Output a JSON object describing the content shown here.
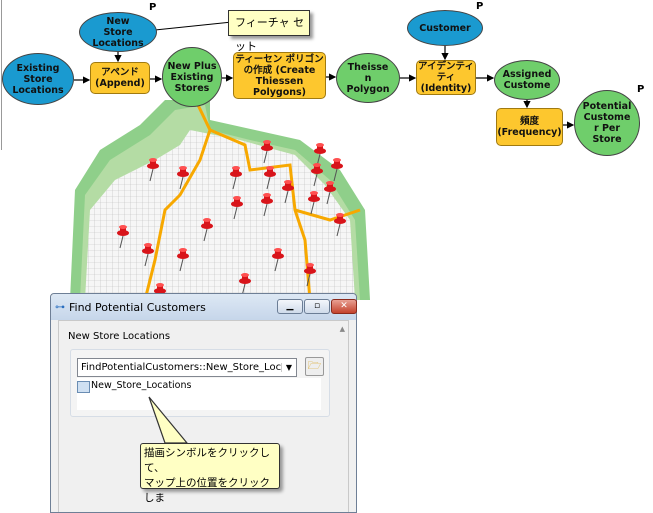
{
  "diagram": {
    "nodes": {
      "existing_store_locations": "Existing Store Locations",
      "new_store_locations": "New Store Locations",
      "append": "アペンド (Append)",
      "new_plus_existing": "New Plus Existing Stores",
      "create_thiessen": "ティーセン ポリゴンの作成 (Create Thiessen Polygons)",
      "thiessen_polygon": "Theisse n Polygon",
      "customer": "Customer",
      "identity": "アイデンティティ (Identity)",
      "assigned_customer": "Assigned Custome",
      "frequency": "頻度 (Frequency)",
      "potential_customer_per_store": "Potential Custome r Per Store"
    },
    "parameter_marker": "P",
    "callout": "フィーチャ セット",
    "colors": {
      "data_input": "#1a9ad0",
      "derived_data": "#6fce6b",
      "tool": "#fdc72e",
      "route": "#f7a800",
      "pin": "#d8141a"
    }
  },
  "dialog": {
    "title": "Find Potential Customers",
    "section_label": "New Store Locations",
    "dropdown_value": "FindPotentialCustomers::New_Store_Locations",
    "layer_item": "New_Store_Locations",
    "tooltip_line1": "描画シンボルをクリックして、",
    "tooltip_line2": "マップ上の位置をクリックしま",
    "icons": [
      "model-icon",
      "minimize-icon",
      "maximize-icon",
      "close-icon",
      "folder-open-icon",
      "feature-layer-icon"
    ]
  }
}
